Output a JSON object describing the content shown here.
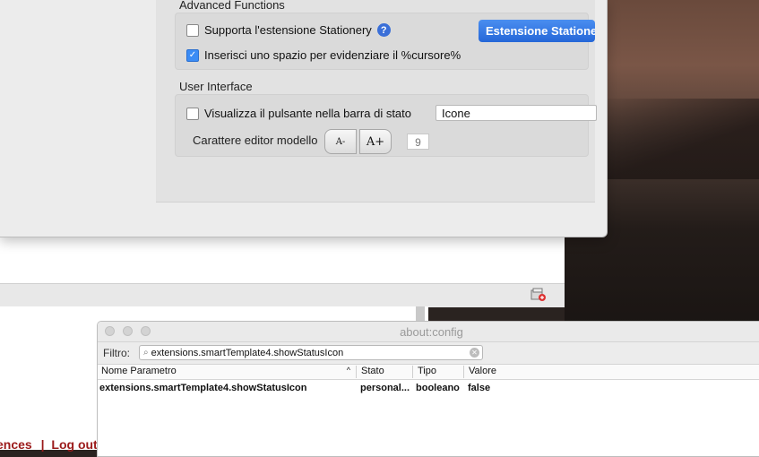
{
  "settings": {
    "advanced_title": "Advanced Functions",
    "stationery_label": "Supporta l'estensione Stationery",
    "stationery_checked": false,
    "help_glyph": "?",
    "stationery_button": "Estensione Stationery",
    "cursor_label": "Inserisci uno spazio per evidenziare il %cursore%",
    "cursor_checked": true,
    "ui_title": "User Interface",
    "statusbar_label": "Visualizza il pulsante nella barra di stato",
    "statusbar_checked": false,
    "display_select_value": "Icone",
    "font_label": "Carattere editor modello",
    "font_decrease": "A-",
    "font_increase": "A+",
    "font_size_value": "9"
  },
  "page": {
    "link1": "ences",
    "separator": "|",
    "link2": "Log out"
  },
  "aboutconfig": {
    "title": "about:config",
    "filter_label": "Filtro:",
    "filter_value": "extensions.smartTemplate4.showStatusIcon",
    "columns": {
      "name": "Nome Parametro",
      "status": "Stato",
      "type": "Tipo",
      "value": "Valore"
    },
    "rows": [
      {
        "name": "extensions.smartTemplate4.showStatusIcon",
        "status": "personal...",
        "type": "booleano",
        "value": "false"
      }
    ]
  },
  "colors": {
    "accent_blue": "#3b8cf5",
    "link_red": "#9b1a1a"
  }
}
